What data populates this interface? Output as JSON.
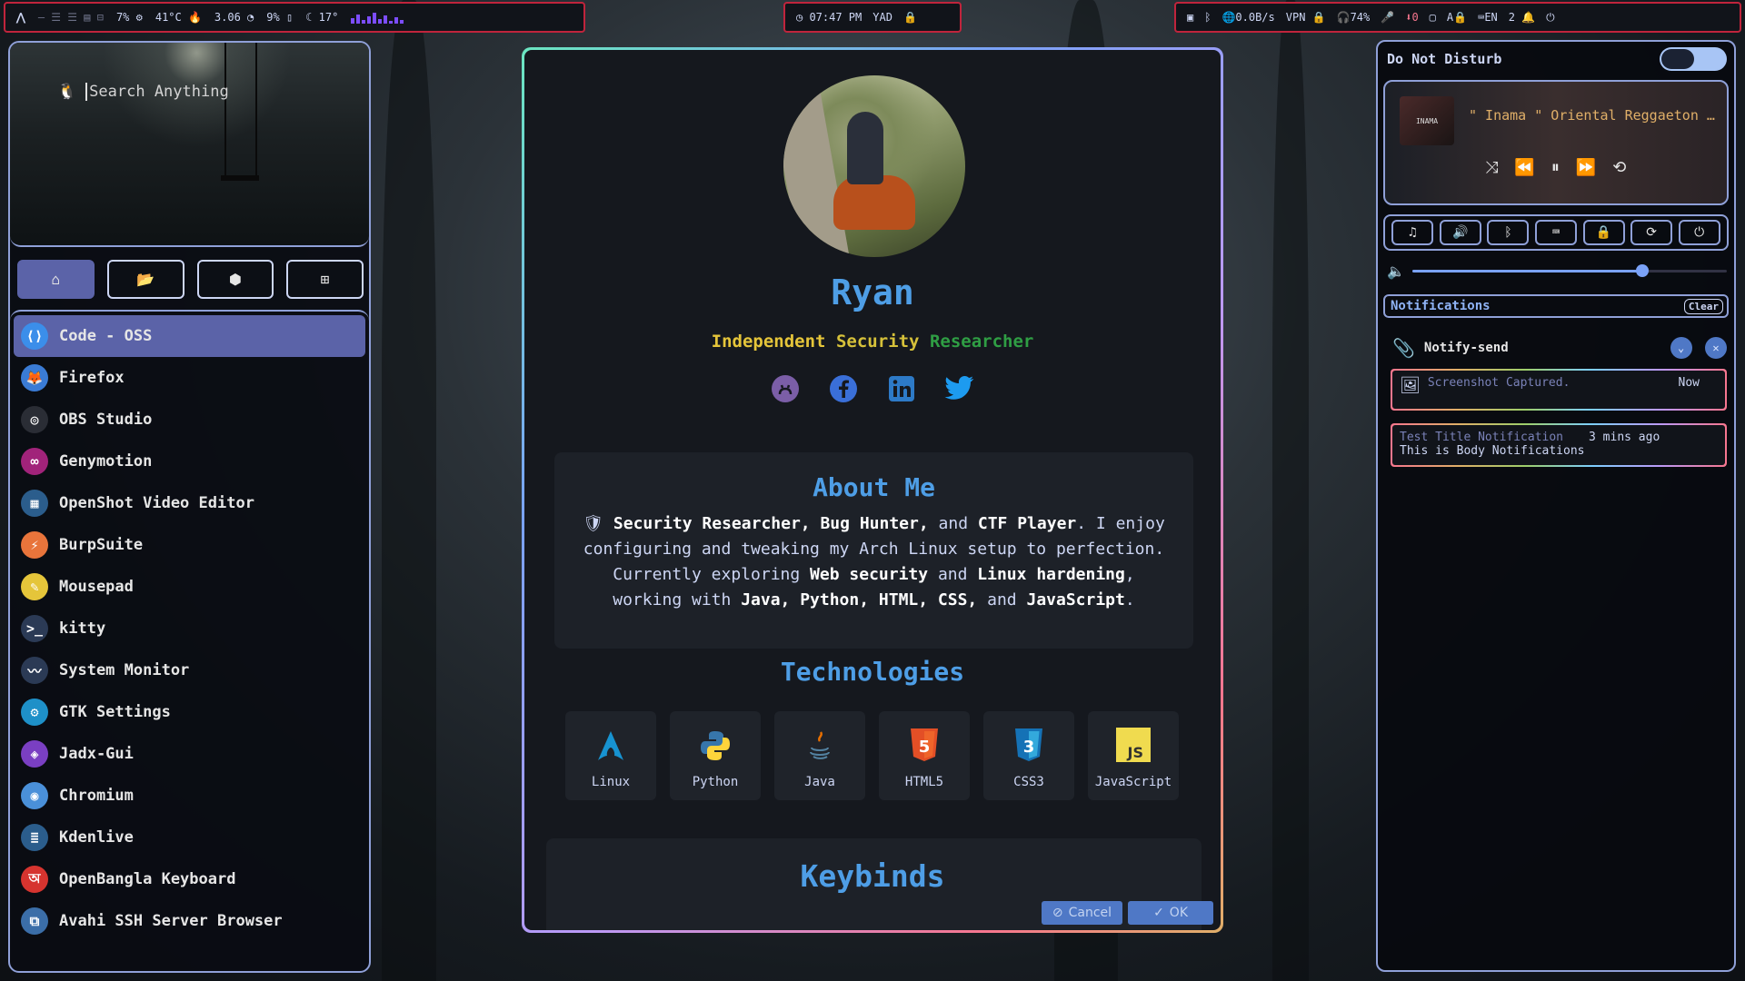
{
  "topbar": {
    "left": {
      "cpu": "7%",
      "temp": "41°C",
      "load": "3.06",
      "memory": "9%",
      "weather": "17°"
    },
    "center": {
      "time": "07:47 PM",
      "app": "YAD"
    },
    "right": {
      "net_speed": "0.0B/s",
      "vpn": "VPN",
      "battery": "74%",
      "updates": "0",
      "keyboard": "EN",
      "notifications": "2"
    }
  },
  "launcher": {
    "search_placeholder": "Search Anything",
    "apps": [
      {
        "label": "Code - OSS",
        "icon": "vscode-icon",
        "color": "#3b8eea"
      },
      {
        "label": "Firefox",
        "icon": "firefox-icon",
        "color": "#3a7bd5"
      },
      {
        "label": "OBS Studio",
        "icon": "obs-icon",
        "color": "#2a2d35"
      },
      {
        "label": "Genymotion",
        "icon": "genymotion-icon",
        "color": "#a1237a"
      },
      {
        "label": "OpenShot Video Editor",
        "icon": "film-icon",
        "color": "#2b5d8c"
      },
      {
        "label": "BurpSuite",
        "icon": "burpsuite-icon",
        "color": "#e8743b"
      },
      {
        "label": "Mousepad",
        "icon": "notepad-icon",
        "color": "#e5c53a"
      },
      {
        "label": "kitty",
        "icon": "terminal-icon",
        "color": "#2b3a55"
      },
      {
        "label": "System Monitor",
        "icon": "monitor-icon",
        "color": "#2b3a55"
      },
      {
        "label": "GTK Settings",
        "icon": "settings-icon",
        "color": "#1e90c8"
      },
      {
        "label": "Jadx-Gui",
        "icon": "jadx-icon",
        "color": "#7a3fc2"
      },
      {
        "label": "Chromium",
        "icon": "chromium-icon",
        "color": "#4a90d9"
      },
      {
        "label": "Kdenlive",
        "icon": "kdenlive-icon",
        "color": "#2b5d8c"
      },
      {
        "label": "OpenBangla Keyboard",
        "icon": "keyboard-icon",
        "color": "#d6342f"
      },
      {
        "label": "Avahi SSH Server Browser",
        "icon": "network-icon",
        "color": "#3b6ea8"
      }
    ]
  },
  "profile": {
    "name": "Ryan",
    "subtitle": [
      "Independent",
      "Security",
      "Researcher"
    ],
    "socials": [
      "github",
      "facebook",
      "linkedin",
      "twitter"
    ],
    "about_title": "About Me",
    "about": {
      "p1_b1": "Security Researcher, Bug Hunter,",
      "p1_t1": "and",
      "p1_b2": "CTF Player",
      "p1_t2": ". I enjoy configuring and tweaking my Arch Linux setup to perfection. Currently exploring",
      "p1_b3": "Web security",
      "p1_t3": "and",
      "p1_b4": "Linux hardening",
      "p1_t4": ", working with",
      "p1_b5": "Java, Python, HTML, CSS,",
      "p1_t5": "and",
      "p1_b6": "JavaScript",
      "p1_t6": "."
    },
    "tech_title": "Technologies",
    "technologies": [
      "Linux",
      "Python",
      "Java",
      "HTML5",
      "CSS3",
      "JavaScript"
    ],
    "keybinds_title": "Keybinds",
    "cancel_label": "Cancel",
    "ok_label": "OK"
  },
  "panel": {
    "dnd_label": "Do Not Disturb",
    "player": {
      "title": "\" Inama \" Oriental Reggaeton …",
      "thumb_text": "INAMA"
    },
    "volume": 0.73,
    "notifications_label": "Notifications",
    "clear_label": "Clear",
    "notif_app": "Notify-send",
    "notifs": [
      {
        "title": "Screenshot Captured.",
        "time": "Now",
        "body": ""
      },
      {
        "title": "Test Title Notification",
        "time": "3 mins ago",
        "body": "This is Body Notifications"
      }
    ]
  }
}
